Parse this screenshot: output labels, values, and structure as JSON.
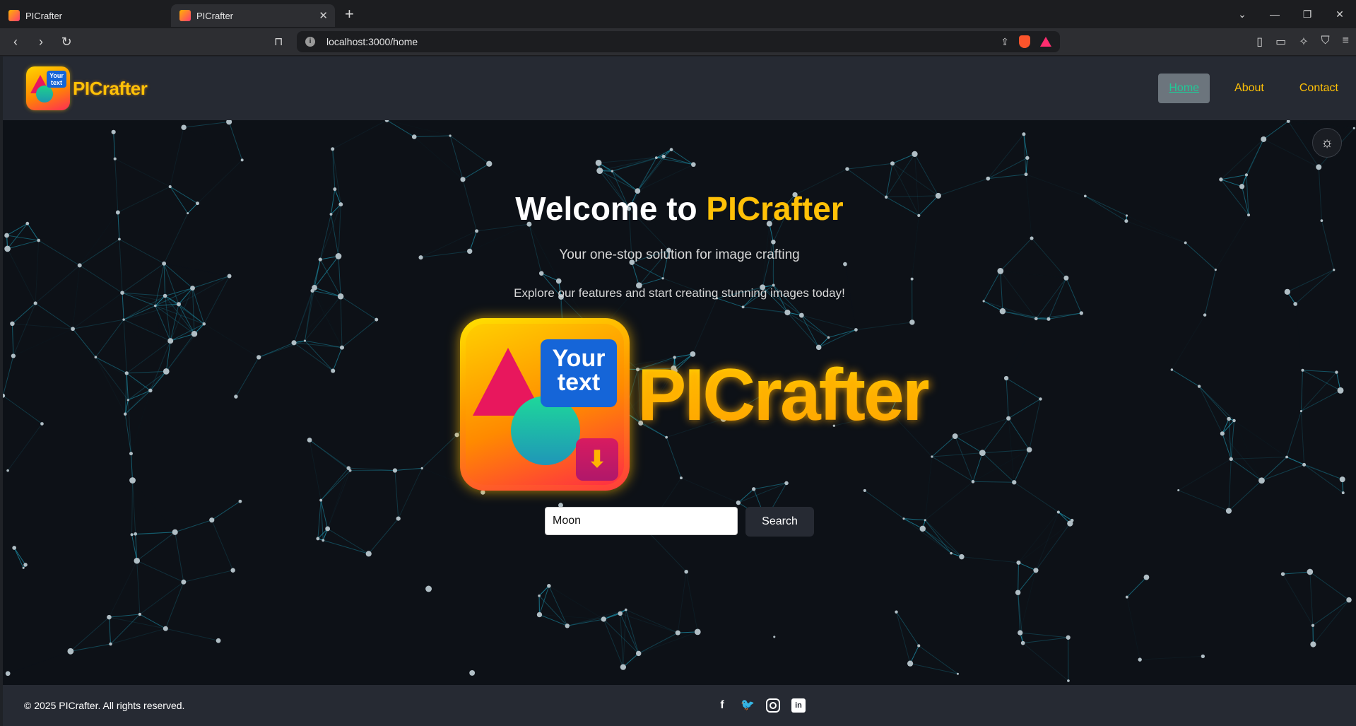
{
  "browser": {
    "tabs": [
      {
        "title": "PICrafter",
        "active": false
      },
      {
        "title": "PICrafter",
        "active": true
      }
    ],
    "url": "localhost:3000/home"
  },
  "navbar": {
    "brand": "PICrafter",
    "logo_box_text": "Your text",
    "links": [
      {
        "label": "Home",
        "active": true
      },
      {
        "label": "About",
        "active": false
      },
      {
        "label": "Contact",
        "active": false
      }
    ]
  },
  "hero": {
    "title_prefix": "Welcome to ",
    "title_accent": "PICrafter",
    "subtitle": "Your one-stop solution for image crafting",
    "description": "Explore our features and start creating stunning images today!",
    "logo_box_text": "Your text",
    "logo_word": "PICrafter"
  },
  "search": {
    "value": "Moon",
    "button_label": "Search"
  },
  "footer": {
    "copyright": "© 2025 PICrafter. All rights reserved.",
    "social": [
      "facebook-icon",
      "twitter-icon",
      "instagram-icon",
      "linkedin-icon"
    ]
  },
  "colors": {
    "accent": "#ffc107",
    "navbar_bg": "#262a33",
    "page_bg": "#0d1117",
    "network_line": "#1fa7c4",
    "network_node": "#b0bec5"
  }
}
